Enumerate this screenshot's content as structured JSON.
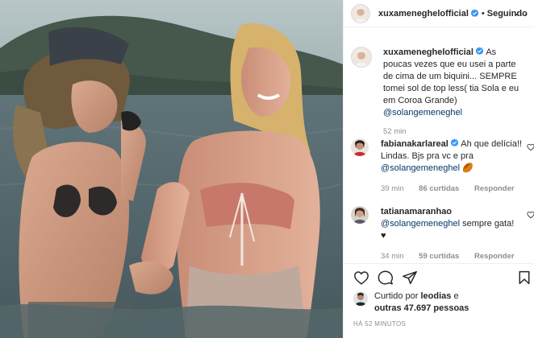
{
  "post": {
    "author": "xuxameneghelofficial",
    "separator": "•",
    "follow_label": "Seguindo",
    "more_label": "···"
  },
  "caption": {
    "author": "xuxameneghelofficial",
    "text": "As poucas vezes que eu usei a parte de cima de um biquini... SEMPRE tomei sol de top less( tia Sola e eu em Coroa Grande)",
    "mention": "@solangemeneghel",
    "time": "52 min"
  },
  "comments": [
    {
      "author": "fabianakarlareal",
      "text": "Ah que delícia!! Lindas. Bjs pra vc e pra",
      "mention": "@solangemeneghel",
      "emoji": "🏉",
      "time": "39 min",
      "likes": "86 curtidas",
      "reply_label": "Responder"
    },
    {
      "author": "tatianamaranhao",
      "mention": "@solangemeneghel",
      "text": "sempre gata!",
      "emoji": "♥",
      "time": "34 min",
      "likes": "59 curtidas",
      "reply_label": "Responder"
    }
  ],
  "liked_by": {
    "prefix": "Curtido por",
    "user": "leodias",
    "middle": "e",
    "others": "outras 47.697 pessoas"
  },
  "posted_ago": "HÁ 52 MINUTOS",
  "icons": [
    "verified-badge-icon",
    "heart-icon",
    "comment-icon",
    "share-icon",
    "bookmark-icon"
  ],
  "colors": {
    "verified": "#3897f0",
    "mention": "#00376b",
    "muted": "#8e8e8e",
    "border": "#efefef"
  }
}
